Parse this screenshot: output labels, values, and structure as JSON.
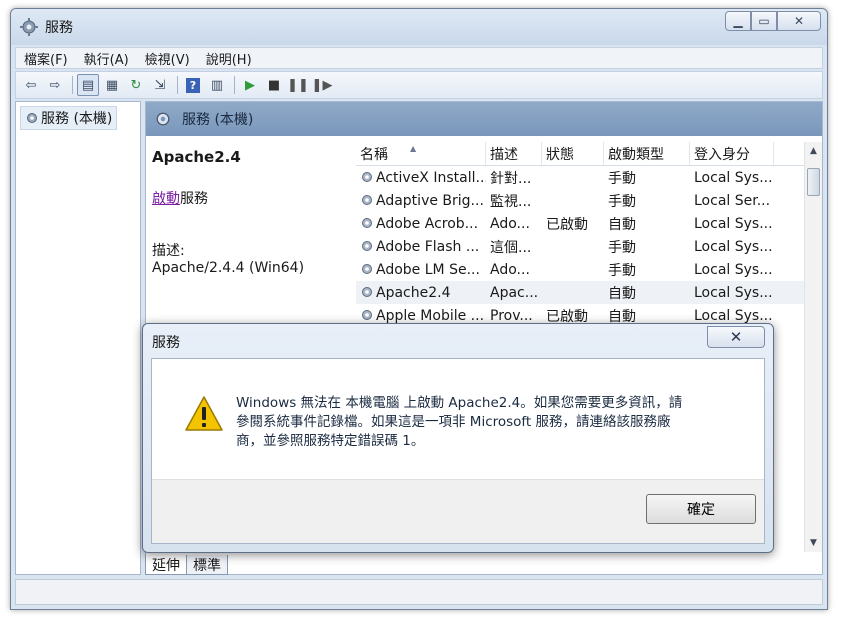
{
  "window": {
    "title": "服務"
  },
  "menu": [
    "檔案(F)",
    "執行(A)",
    "檢視(V)",
    "說明(H)"
  ],
  "tree": {
    "item": "服務 (本機)"
  },
  "pane": {
    "header": "服務 (本機)",
    "selected_name": "Apache2.4",
    "start_link": "啟動",
    "start_suffix": "服務",
    "desc_label": "描述:",
    "desc_value": "Apache/2.4.4 (Win64)"
  },
  "list": {
    "columns": [
      "名稱",
      "描述",
      "狀態",
      "啟動類型",
      "登入身分"
    ],
    "rows": [
      {
        "name": "ActiveX Install...",
        "desc": "針對...",
        "state": "",
        "start": "手動",
        "logon": "Local Sys..."
      },
      {
        "name": "Adaptive Brig...",
        "desc": "監視...",
        "state": "",
        "start": "手動",
        "logon": "Local Ser..."
      },
      {
        "name": "Adobe Acrob...",
        "desc": "Ado...",
        "state": "已啟動",
        "start": "自動",
        "logon": "Local Sys..."
      },
      {
        "name": "Adobe Flash ...",
        "desc": "這個...",
        "state": "",
        "start": "手動",
        "logon": "Local Sys..."
      },
      {
        "name": "Adobe LM Se...",
        "desc": "Ado...",
        "state": "",
        "start": "手動",
        "logon": "Local Sys..."
      },
      {
        "name": "Apache2.4",
        "desc": "Apac...",
        "state": "",
        "start": "自動",
        "logon": "Local Sys..."
      },
      {
        "name": "Apple Mobile ...",
        "desc": "Prov...",
        "state": "已啟動",
        "start": "自動",
        "logon": "Local Sys..."
      }
    ]
  },
  "tabs": [
    "延伸",
    "標準"
  ],
  "dialog": {
    "title": "服務",
    "message_line1": "Windows 無法在 本機電腦 上啟動 Apache2.4。如果您需要更多資訊，請",
    "message_line2": "參閱系統事件記錄檔。如果這是一項非 Microsoft 服務，請連絡該服務廠",
    "message_line3": "商，並參照服務特定錯誤碼 1。",
    "ok_label": "確定"
  }
}
